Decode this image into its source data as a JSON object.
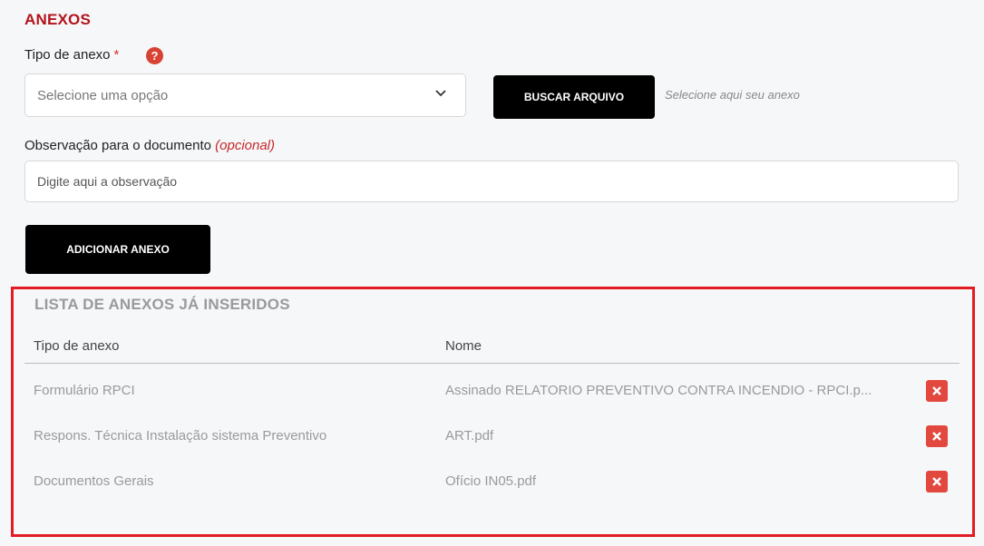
{
  "section": {
    "title": "ANEXOS"
  },
  "form": {
    "tipo_label": "Tipo de anexo",
    "required_mark": "*",
    "help_glyph": "?",
    "select_placeholder": "Selecione uma opção",
    "buscar_button": "BUSCAR ARQUIVO",
    "file_hint": "Selecione aqui seu anexo",
    "obs_label": "Observação para o documento",
    "obs_optional": "(opcional)",
    "obs_placeholder": "Digite aqui a observação",
    "adicionar_button": "ADICIONAR ANEXO"
  },
  "list": {
    "title": "LISTA DE ANEXOS JÁ INSERIDOS",
    "columns": [
      "Tipo de anexo",
      "Nome"
    ],
    "rows": [
      {
        "tipo": "Formulário RPCI",
        "nome": "Assinado RELATORIO PREVENTIVO CONTRA INCENDIO - RPCI.p..."
      },
      {
        "tipo": "Respons. Técnica Instalação sistema Preventivo",
        "nome": "ART.pdf"
      },
      {
        "tipo": "Documentos Gerais",
        "nome": "Ofício IN05.pdf"
      }
    ]
  },
  "colors": {
    "title_red": "#b3141a",
    "highlight_border": "#e31b23",
    "delete_button": "#e2483d",
    "help_icon": "#d84234"
  },
  "icons": {
    "help": "question-circle-icon",
    "chevron": "chevron-down-icon",
    "delete": "close-icon"
  }
}
